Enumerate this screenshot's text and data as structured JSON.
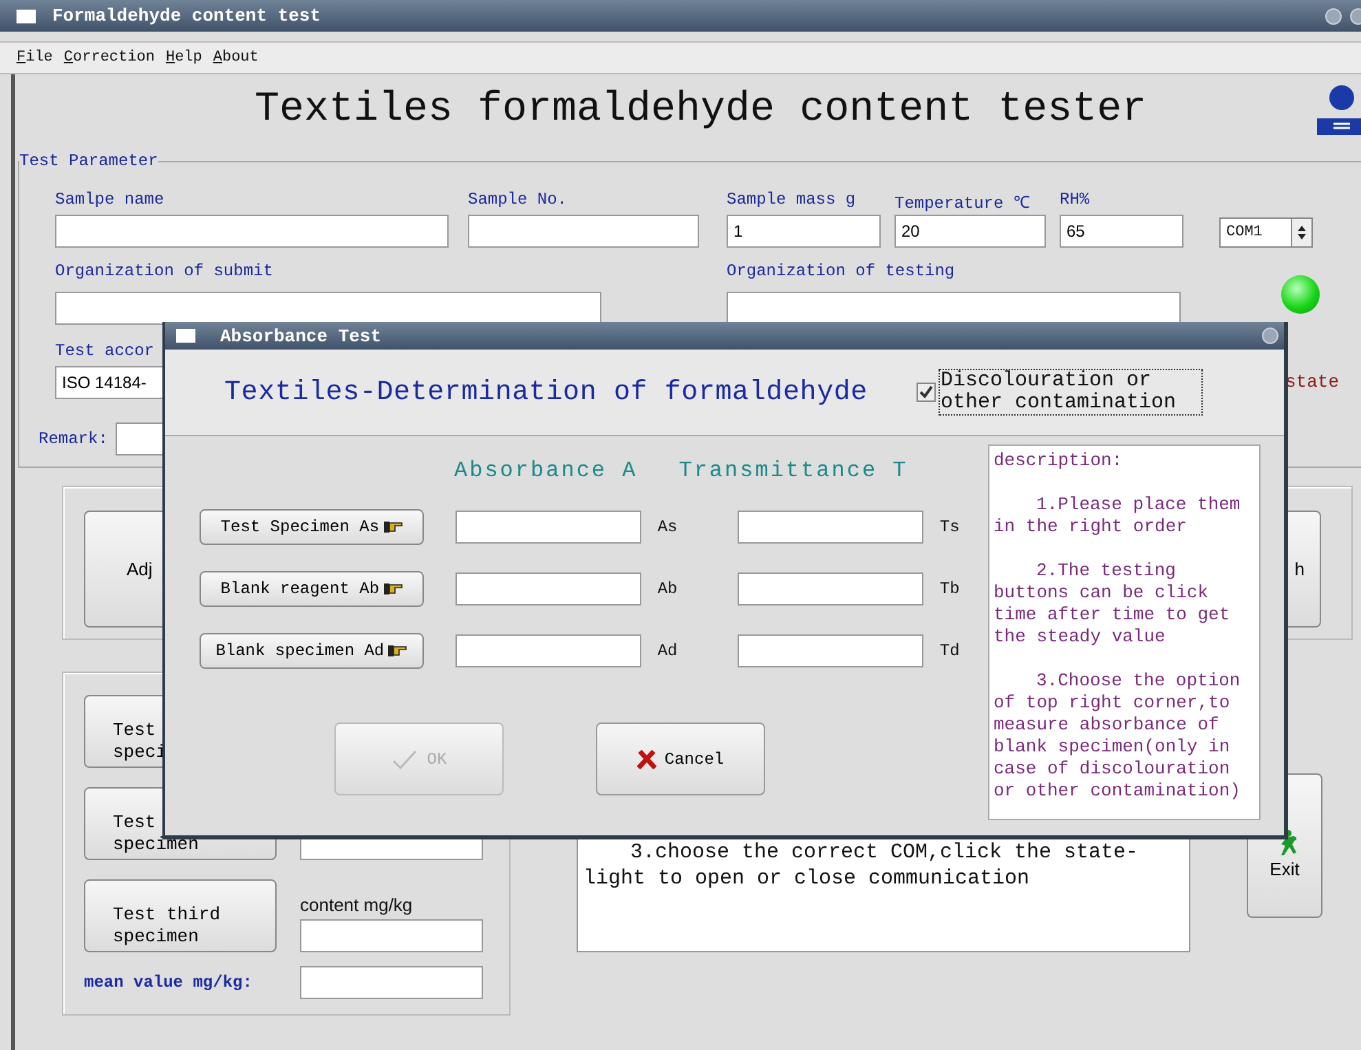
{
  "window": {
    "title": "Formaldehyde content test"
  },
  "menu": [
    {
      "label": "File"
    },
    {
      "label": "Correction"
    },
    {
      "label": "Help"
    },
    {
      "label": "About"
    }
  ],
  "heading": "Textiles formaldehyde content tester",
  "test_parameter": {
    "title": "Test Parameter",
    "rows": [
      {
        "kind": "stacked",
        "fields": [
          {
            "label": "Samlpe name"
          },
          {
            "label": "Sample No."
          },
          {
            "label": "Sample mass g",
            "value": "1"
          },
          {
            "label": "Temperature ℃",
            "value": "20"
          },
          {
            "label": "RH%",
            "value": "65"
          }
        ]
      },
      {
        "kind": "stacked",
        "fields": [
          {
            "label": "Organization of submit"
          },
          {
            "label": "Organization of testing"
          }
        ]
      },
      {
        "kind": "stacked",
        "fields": [
          {
            "label": "Test accor",
            "value": "ISO 14184-"
          }
        ]
      },
      {
        "kind": "inline",
        "fields": [
          {
            "label": "Remark:"
          }
        ]
      }
    ],
    "port": {
      "value": "COM1"
    },
    "status_light": {
      "label": "state",
      "on": true
    }
  },
  "adjust_buttons": [
    {
      "label": "Adj"
    },
    {
      "label": "h"
    }
  ],
  "specimen_tests": [
    {
      "kind": "button",
      "lines": [
        "Test",
        "speci"
      ]
    },
    {
      "kind": "field",
      "lines": [
        "Test",
        "specimen"
      ]
    },
    {
      "kind": "labeled",
      "lines": [
        "Test third",
        "specimen"
      ],
      "content_label": "content mg/kg"
    }
  ],
  "mean_label": "mean value mg/kg:",
  "instructions": "3.choose the correct COM,click the state-light to open or close communication",
  "exit_button": {
    "label": "Exit"
  },
  "dialog": {
    "title": "Absorbance Test",
    "heading": "Textiles-Determination of formaldehyde",
    "option": {
      "label": "Discolouration or other contamination",
      "checked": true
    },
    "columns": [
      "Absorbance A",
      "Transmittance T"
    ],
    "rows": [
      {
        "button": "Test Specimen As",
        "a_unit": "As",
        "t_unit": "Ts"
      },
      {
        "button": "Blank reagent Ab",
        "a_unit": "Ab",
        "t_unit": "Tb"
      },
      {
        "button": "Blank specimen Ad",
        "a_unit": "Ad",
        "t_unit": "Td"
      }
    ],
    "description": {
      "title": "description:",
      "items": [
        "1.Please place them in the right order",
        "2.The testing buttons can be click time after time to get the steady value",
        "3.Choose the option of top right corner,to measure absorbance of blank specimen(only in case of discolouration or other contamination)"
      ]
    },
    "buttons": [
      {
        "kind": "ok",
        "label": "OK",
        "disabled": true
      },
      {
        "kind": "cancel",
        "label": "Cancel",
        "disabled": false
      }
    ]
  }
}
